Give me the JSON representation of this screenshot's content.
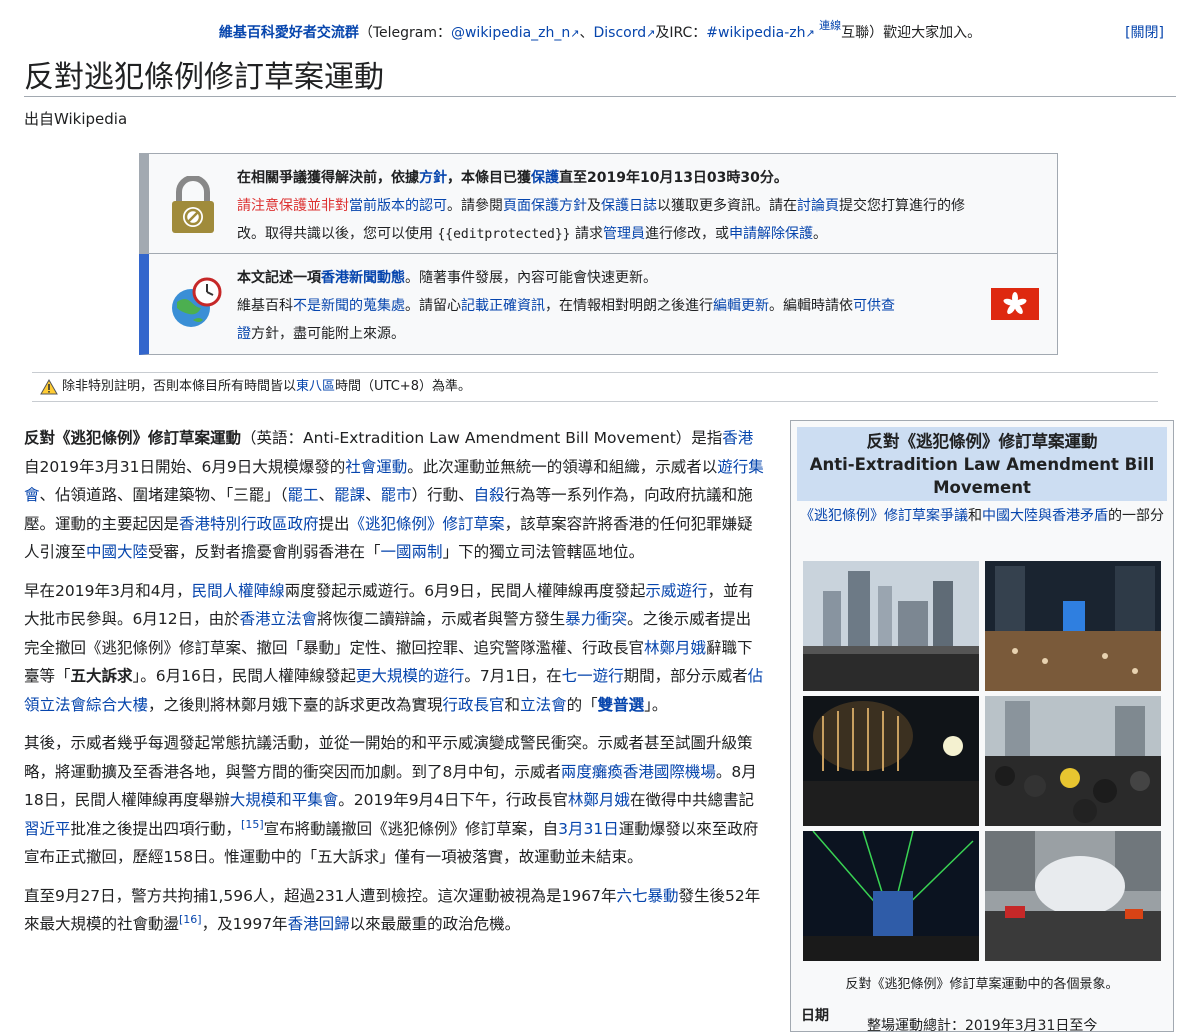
{
  "sitenotice": {
    "group": "維基百科愛好者交流群",
    "open": "（Telegram：",
    "telegram": "@wikipedia_zh_n",
    "sep1": "、",
    "discord": "Discord",
    "and": "及IRC：",
    "irc": "#wikipedia-zh",
    "bridge": "連線",
    "rest": "互聯）歡迎大家加入。",
    "dismiss": "[關閉]"
  },
  "page": {
    "title": "反對逃犯條例修訂草案運動",
    "from": "出自Wikipedia"
  },
  "protect_box": {
    "line1_a": "在相關爭議獲得解決前，依據",
    "line1_link1": "方針",
    "line1_b": "，本條目已獲",
    "line1_link2": "保護",
    "line1_c": "直至2019年10月13日03時30分。",
    "line2_red": "請注意保護並非對",
    "line2_link": "當前版本的認可",
    "line2_a": "。請參閱",
    "line2_link2": "頁面保護方針",
    "line2_b": "及",
    "line2_link3": "保護日誌",
    "line2_c": "以獲取更多資訊。請在",
    "line2_link4": "討論頁",
    "line2_d": "提交您打算進行的修",
    "line3_a": "改。取得共識以後，您可以使用 ",
    "line3_code": "{{editprotected}}",
    "line3_b": " 請求",
    "line3_link1": "管理員",
    "line3_c": "進行修改，或",
    "line3_link2": "申請解除保護",
    "line3_d": "。"
  },
  "news_box": {
    "line1_a": "本文記述一項",
    "line1_link": "香港新聞動態",
    "line1_b": "。隨著事件發展，內容可能會快速更新。",
    "line2_a": "維基百科",
    "line2_link1": "不是新聞的蒐集處",
    "line2_b": "。請留心",
    "line2_link2": "記載正確資訊",
    "line2_c": "，在情報相對明朗之後進行",
    "line2_link3": "編輯更新",
    "line2_d": "。編輯時請依",
    "line2_link4": "可供查",
    "line3_link": "證",
    "line3_a": "方針，盡可能附上來源。"
  },
  "tz_note": {
    "a": "除非特別註明，否則本條目所有時間皆以",
    "link": "東八區",
    "b": "時間（UTC+8）為準。"
  },
  "infobox": {
    "title_zh": "反對《逃犯條例》修訂草案運動",
    "title_en": "Anti-Extradition Law Amendment Bill Movement",
    "sub_link1": "《逃犯條例》修訂草案爭議",
    "sub_and": "和",
    "sub_link2": "中國大陸與香港矛盾",
    "sub_tail": "的一部分",
    "caption": "反對《逃犯條例》修訂草案運動中的各個景象。",
    "row_label": "日期",
    "row_value": "整場運動總計：2019年3月31日至今"
  },
  "article": {
    "p1": [
      {
        "t": "反對《逃犯條例》修訂草案運動",
        "b": true
      },
      {
        "t": "（英語：Anti-Extradition Law Amendment Bill Movement）是指"
      },
      {
        "t": "香港",
        "l": true
      },
      {
        "t": "自2019年3月31日開始、6月9日大規模爆發的"
      },
      {
        "t": "社會運動",
        "l": true
      },
      {
        "t": "。此次運動並無統一的領導和組織，示威者以"
      },
      {
        "t": "遊行集會",
        "l": true
      },
      {
        "t": "、佔領道路、圍堵建築物、「三罷」（"
      },
      {
        "t": "罷工",
        "l": true
      },
      {
        "t": "、"
      },
      {
        "t": "罷課",
        "l": true
      },
      {
        "t": "、"
      },
      {
        "t": "罷市",
        "l": true
      },
      {
        "t": "）行動、"
      },
      {
        "t": "自殺",
        "l": true
      },
      {
        "t": "行為等一系列作為，向政府抗議和施壓。運動的主要起因是"
      },
      {
        "t": "香港特別行政區政府",
        "l": true
      },
      {
        "t": "提出"
      },
      {
        "t": "《逃犯條例》修訂草案",
        "l": true
      },
      {
        "t": "，該草案容許將香港的任何犯罪嫌疑人引渡至"
      },
      {
        "t": "中國大陸",
        "l": true
      },
      {
        "t": "受審，反對者擔憂會削弱香港在「"
      },
      {
        "t": "一國兩制",
        "l": true
      },
      {
        "t": "」下的獨立司法管轄區地位。"
      }
    ],
    "p2": [
      {
        "t": "早在2019年3月和4月，"
      },
      {
        "t": "民間人權陣線",
        "l": true
      },
      {
        "t": "兩度發起示威遊行。6月9日，民間人權陣線再度發起"
      },
      {
        "t": "示威遊行",
        "l": true
      },
      {
        "t": "，並有大批市民參與。6月12日，由於"
      },
      {
        "t": "香港立法會",
        "l": true
      },
      {
        "t": "將恢復二讀辯論，示威者與警方發生"
      },
      {
        "t": "暴力衝突",
        "l": true
      },
      {
        "t": "。之後示威者提出完全撤回《逃犯條例》修訂草案、撤回「暴動」定性、撤回控罪、追究警隊濫權、行政長官"
      },
      {
        "t": "林鄭月娥",
        "l": true
      },
      {
        "t": "辭職下臺等「"
      },
      {
        "t": "五大訴求",
        "b": true
      },
      {
        "t": "」。6月16日，民間人權陣線發起"
      },
      {
        "t": "更大規模的遊行",
        "l": true
      },
      {
        "t": "。7月1日，在"
      },
      {
        "t": "七一遊行",
        "l": true
      },
      {
        "t": "期間，部分示威者"
      },
      {
        "t": "佔領立法會綜合大樓",
        "l": true
      },
      {
        "t": "，之後則將林鄭月娥下臺的訴求更改為實現"
      },
      {
        "t": "行政長官",
        "l": true
      },
      {
        "t": "和"
      },
      {
        "t": "立法會",
        "l": true
      },
      {
        "t": "的「"
      },
      {
        "t": "雙普選",
        "l": true,
        "b": true
      },
      {
        "t": "」。"
      }
    ],
    "p3": [
      {
        "t": "其後，示威者幾乎每週發起常態抗議活動，並從一開始的和平示威演變成警民衝突。示威者甚至試圖升級策略，將運動擴及至香港各地，與警方間的衝突因而加劇。到了8月中旬，示威者"
      },
      {
        "t": "兩度癱瘓香港國際機場",
        "l": true
      },
      {
        "t": "。8月18日，民間人權陣線再度舉辦"
      },
      {
        "t": "大規模和平集會",
        "l": true
      },
      {
        "t": "。2019年9月4日下午，行政長官"
      },
      {
        "t": "林鄭月娥",
        "l": true
      },
      {
        "t": "在徵得中共總書記"
      },
      {
        "t": "習近平",
        "l": true
      },
      {
        "t": "批准之後提出四項行動，"
      },
      {
        "t": "[15]",
        "l": true,
        "sup": true
      },
      {
        "t": "宣布將動議撤回《逃犯條例》修訂草案，自"
      },
      {
        "t": "3月31日",
        "l": true
      },
      {
        "t": "運動爆發以來至政府宣布正式撤回，歷經158日。惟運動中的「五大訴求」僅有一項被落實，故運動並未結束。"
      }
    ],
    "p4": [
      {
        "t": "直至9月27日，警方共拘捕1,596人，超過231人遭到檢控。這次運動被視為是1967年"
      },
      {
        "t": "六七暴動",
        "l": true
      },
      {
        "t": "發生後52年來最大規模的社會動盪"
      },
      {
        "t": "[16]",
        "l": true,
        "sup": true
      },
      {
        "t": "，及1997年"
      },
      {
        "t": "香港回歸",
        "l": true
      },
      {
        "t": "以來最嚴重的政治危機。"
      }
    ]
  }
}
